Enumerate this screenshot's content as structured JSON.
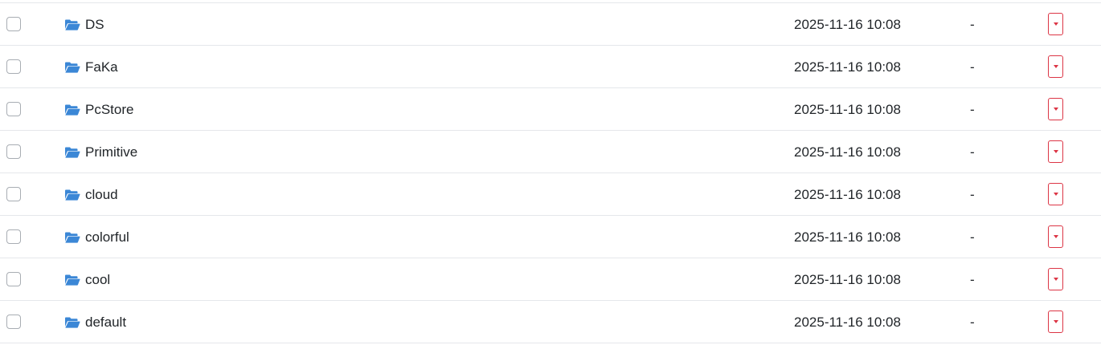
{
  "colors": {
    "folder_icon": "#3b87d6",
    "action_border": "#dc3545",
    "divider": "#e5e7eb",
    "text": "#212529"
  },
  "rows": [
    {
      "name": "DS",
      "modified": "2025-11-16 10:08",
      "size": "-",
      "icon": "folder-open-icon",
      "action_icon": "caret-down-icon"
    },
    {
      "name": "FaKa",
      "modified": "2025-11-16 10:08",
      "size": "-",
      "icon": "folder-open-icon",
      "action_icon": "caret-down-icon"
    },
    {
      "name": "PcStore",
      "modified": "2025-11-16 10:08",
      "size": "-",
      "icon": "folder-open-icon",
      "action_icon": "caret-down-icon"
    },
    {
      "name": "Primitive",
      "modified": "2025-11-16 10:08",
      "size": "-",
      "icon": "folder-open-icon",
      "action_icon": "caret-down-icon"
    },
    {
      "name": "cloud",
      "modified": "2025-11-16 10:08",
      "size": "-",
      "icon": "folder-open-icon",
      "action_icon": "caret-down-icon"
    },
    {
      "name": "colorful",
      "modified": "2025-11-16 10:08",
      "size": "-",
      "icon": "folder-open-icon",
      "action_icon": "caret-down-icon"
    },
    {
      "name": "cool",
      "modified": "2025-11-16 10:08",
      "size": "-",
      "icon": "folder-open-icon",
      "action_icon": "caret-down-icon"
    },
    {
      "name": "default",
      "modified": "2025-11-16 10:08",
      "size": "-",
      "icon": "folder-open-icon",
      "action_icon": "caret-down-icon"
    }
  ]
}
